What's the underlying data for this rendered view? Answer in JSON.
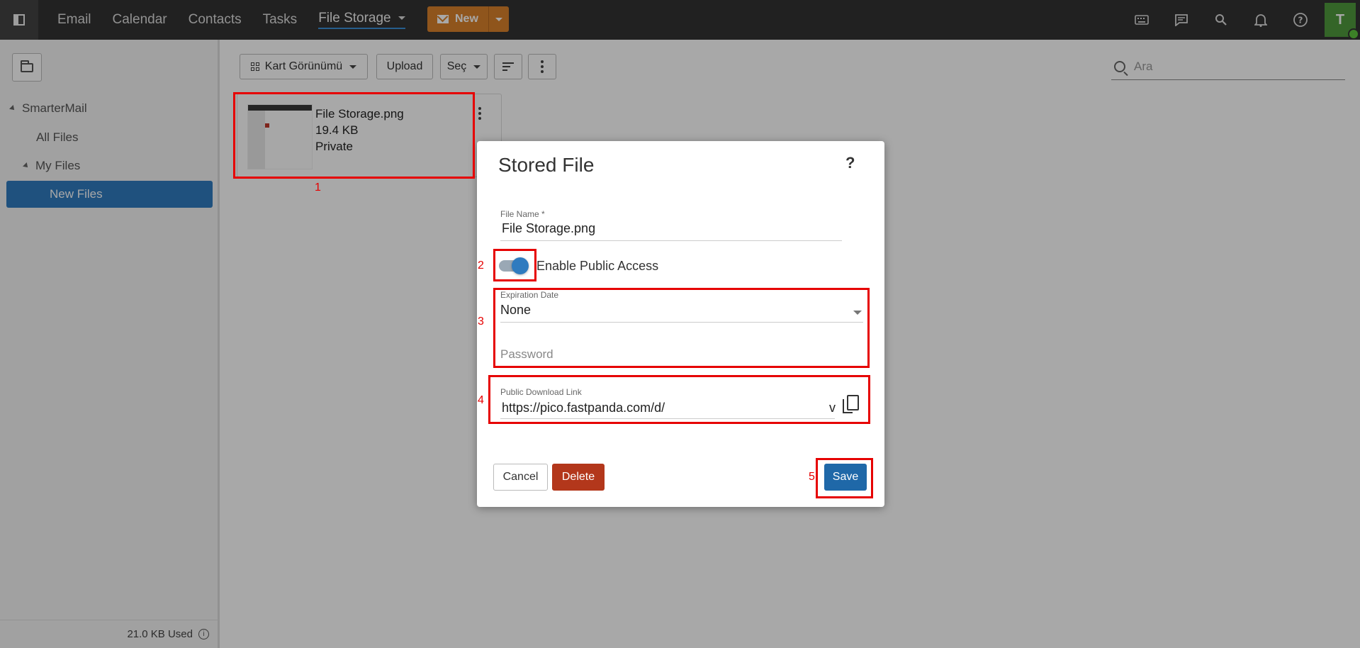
{
  "topbar": {
    "nav": [
      "Email",
      "Calendar",
      "Contacts",
      "Tasks"
    ],
    "active_nav": "File Storage",
    "new_label": "New",
    "icons": [
      "keyboard-icon",
      "chat-icon",
      "search-icon",
      "bell-icon",
      "help-icon"
    ],
    "avatar_initial": "T"
  },
  "sidebar": {
    "root": "SmarterMail",
    "all_files": "All Files",
    "my_files": "My Files",
    "selected": "New Files",
    "usage": "21.0 KB Used"
  },
  "toolbar": {
    "view_label": "Kart Görünümü",
    "upload_label": "Upload",
    "select_label": "Seç",
    "search_placeholder": "Ara"
  },
  "file": {
    "name": "File Storage.png",
    "size": "19.4 KB",
    "visibility": "Private"
  },
  "modal": {
    "title": "Stored File",
    "help": "?",
    "file_name_label": "File Name *",
    "file_name_value": "File Storage.png",
    "public_access_label": "Enable Public Access",
    "public_access_on": true,
    "expiration_label": "Expiration Date",
    "expiration_value": "None",
    "password_placeholder": "Password",
    "link_label": "Public Download Link",
    "link_value": "https://pico.fastpanda.com/d/",
    "link_tail": "v",
    "cancel_label": "Cancel",
    "delete_label": "Delete",
    "save_label": "Save"
  },
  "annotations": [
    "1",
    "2",
    "3",
    "4",
    "5"
  ],
  "colors": {
    "accent": "#2f7bbf",
    "new_button": "#d9822b",
    "delete_button": "#b3371b",
    "annotation": "#e60000"
  }
}
